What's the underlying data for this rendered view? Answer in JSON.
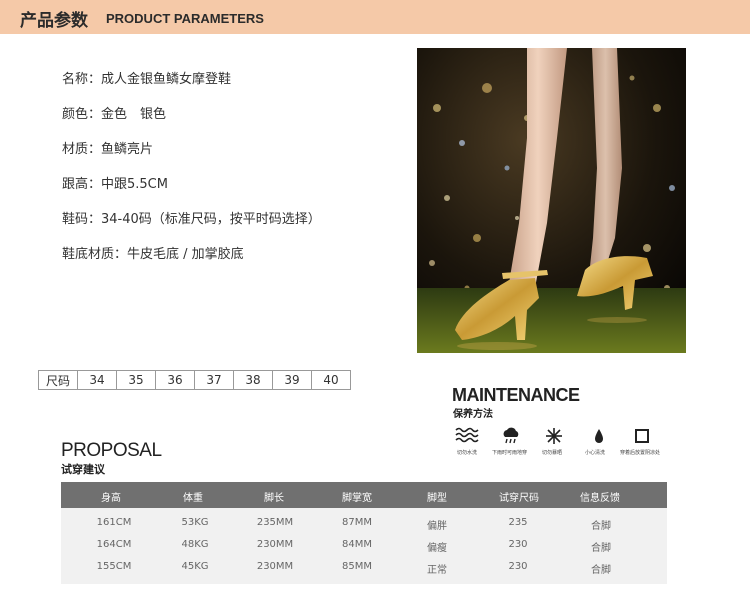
{
  "header": {
    "title_cn": "产品参数",
    "title_en": "PRODUCT PARAMETERS"
  },
  "specs": [
    "名称：成人金银鱼鳞女摩登鞋",
    "颜色：金色　银色",
    "材质：鱼鳞亮片",
    "跟高：中跟5.5CM",
    "鞋码：34-40码（标准尺码，按平时码选择）",
    "鞋底材质：牛皮毛底 / 加掌胶底"
  ],
  "size_table": {
    "label": "尺码",
    "sizes": [
      "34",
      "35",
      "36",
      "37",
      "38",
      "39",
      "40"
    ]
  },
  "maintenance": {
    "title": "MAINTENANCE",
    "subtitle": "保养方法",
    "items": [
      {
        "icon": "water-wash-icon",
        "label": "切勿水洗"
      },
      {
        "icon": "no-sun-exposure-icon",
        "label": "下雨时可雨地穿"
      },
      {
        "icon": "no-bleach-icon",
        "label": "切勿暴晒"
      },
      {
        "icon": "careful-cleaning-icon",
        "label": "小心清洗"
      },
      {
        "icon": "store-ventilated-icon",
        "label": "穿着后放置阴凉处"
      }
    ]
  },
  "proposal": {
    "title": "PROPOSAL",
    "subtitle": "试穿建议",
    "columns": [
      "身高",
      "体重",
      "脚长",
      "脚掌宽",
      "脚型",
      "试穿尺码",
      "信息反馈"
    ],
    "rows": [
      [
        "161CM",
        "53KG",
        "235MM",
        "87MM",
        "偏胖",
        "235",
        "合脚"
      ],
      [
        "164CM",
        "48KG",
        "230MM",
        "84MM",
        "偏瘦",
        "230",
        "合脚"
      ],
      [
        "155CM",
        "45KG",
        "230MM",
        "85MM",
        "正常",
        "230",
        "合脚"
      ]
    ]
  },
  "colors": {
    "header_bg": "#f5c9a8",
    "table_head_bg": "#707070",
    "shoe_gold": "#d9b24a"
  }
}
